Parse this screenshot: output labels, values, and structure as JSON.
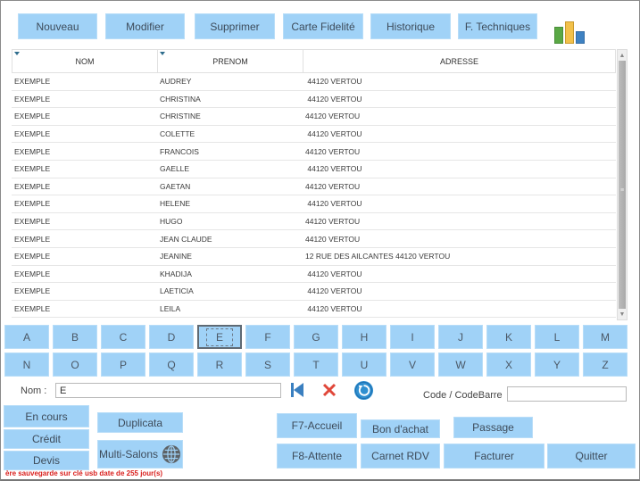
{
  "toolbar": {
    "buttons": [
      {
        "label": "Nouveau"
      },
      {
        "label": "Modifier"
      },
      {
        "label": "Supprimer"
      },
      {
        "label": "Carte Fidelité"
      },
      {
        "label": "Historique"
      },
      {
        "label": "F. Techniques"
      }
    ],
    "stats_icon": "bar-chart-icon",
    "stats_colors": [
      "#5aa845",
      "#f2c14a",
      "#3f82c2"
    ]
  },
  "grid": {
    "columns": [
      {
        "label": "NOM",
        "sorted": true
      },
      {
        "label": "PRENOM",
        "sorted": true
      },
      {
        "label": "ADRESSE",
        "sorted": false
      }
    ],
    "rows": [
      {
        "nom": "EXEMPLE",
        "prenom": "AUDREY",
        "adresse": " 44120 VERTOU"
      },
      {
        "nom": "EXEMPLE",
        "prenom": "CHRISTINA",
        "adresse": " 44120 VERTOU"
      },
      {
        "nom": "EXEMPLE",
        "prenom": "CHRISTINE",
        "adresse": "44120 VERTOU"
      },
      {
        "nom": "EXEMPLE",
        "prenom": "COLETTE",
        "adresse": " 44120 VERTOU"
      },
      {
        "nom": "EXEMPLE",
        "prenom": "FRANCOIS",
        "adresse": "44120 VERTOU"
      },
      {
        "nom": "EXEMPLE",
        "prenom": "GAELLE",
        "adresse": " 44120 VERTOU"
      },
      {
        "nom": "EXEMPLE",
        "prenom": "GAETAN",
        "adresse": "44120 VERTOU"
      },
      {
        "nom": "EXEMPLE",
        "prenom": "HELENE",
        "adresse": " 44120 VERTOU"
      },
      {
        "nom": "EXEMPLE",
        "prenom": "HUGO",
        "adresse": "44120 VERTOU"
      },
      {
        "nom": "EXEMPLE",
        "prenom": "JEAN CLAUDE",
        "adresse": "44120 VERTOU"
      },
      {
        "nom": "EXEMPLE",
        "prenom": "JEANINE",
        "adresse": "12 RUE DES AILCANTES 44120 VERTOU"
      },
      {
        "nom": "EXEMPLE",
        "prenom": "KHADIJA",
        "adresse": " 44120 VERTOU"
      },
      {
        "nom": "EXEMPLE",
        "prenom": "LAETICIA",
        "adresse": " 44120 VERTOU"
      },
      {
        "nom": "EXEMPLE",
        "prenom": "LEILA",
        "adresse": " 44120 VERTOU"
      }
    ],
    "scroll_up": "▲",
    "scroll_down": "▼",
    "scroll_grip": "≡"
  },
  "alphabet": {
    "row1": [
      "A",
      "B",
      "C",
      "D",
      "E",
      "F",
      "G",
      "H",
      "I",
      "J",
      "K",
      "L",
      "M"
    ],
    "row2": [
      "N",
      "O",
      "P",
      "Q",
      "R",
      "S",
      "T",
      "U",
      "V",
      "W",
      "X",
      "Y",
      "Z"
    ],
    "selected": "E"
  },
  "search": {
    "nom_label": "Nom :",
    "nom_value": "E",
    "code_label": "Code / CodeBarre",
    "code_value": "",
    "first_icon": "skip-to-first-icon",
    "clear_icon": "clear-icon",
    "refresh_icon": "refresh-icon"
  },
  "bottom": {
    "en_cours": "En cours",
    "credit": "Crédit",
    "devis": "Devis",
    "duplicata": "Duplicata",
    "multi_salons": "Multi-Salons",
    "f7_accueil": "F7-Accueil",
    "bon_achat": "Bon d'achat",
    "passage": "Passage",
    "f8_attente": "F8-Attente",
    "carnet_rdv": "Carnet RDV",
    "facturer": "Facturer",
    "quitter": "Quitter"
  },
  "status": {
    "warning": "ère sauvegarde sur clé usb date de 255 jour(s)",
    "warning_color": "#d9201e"
  },
  "colors": {
    "button_bg": "#a0d2f7",
    "sort_indicator": "#2f6d8d",
    "clear_red": "#e0473a",
    "refresh_blue": "#2f8fd0",
    "first_blue": "#3a7fc0"
  }
}
